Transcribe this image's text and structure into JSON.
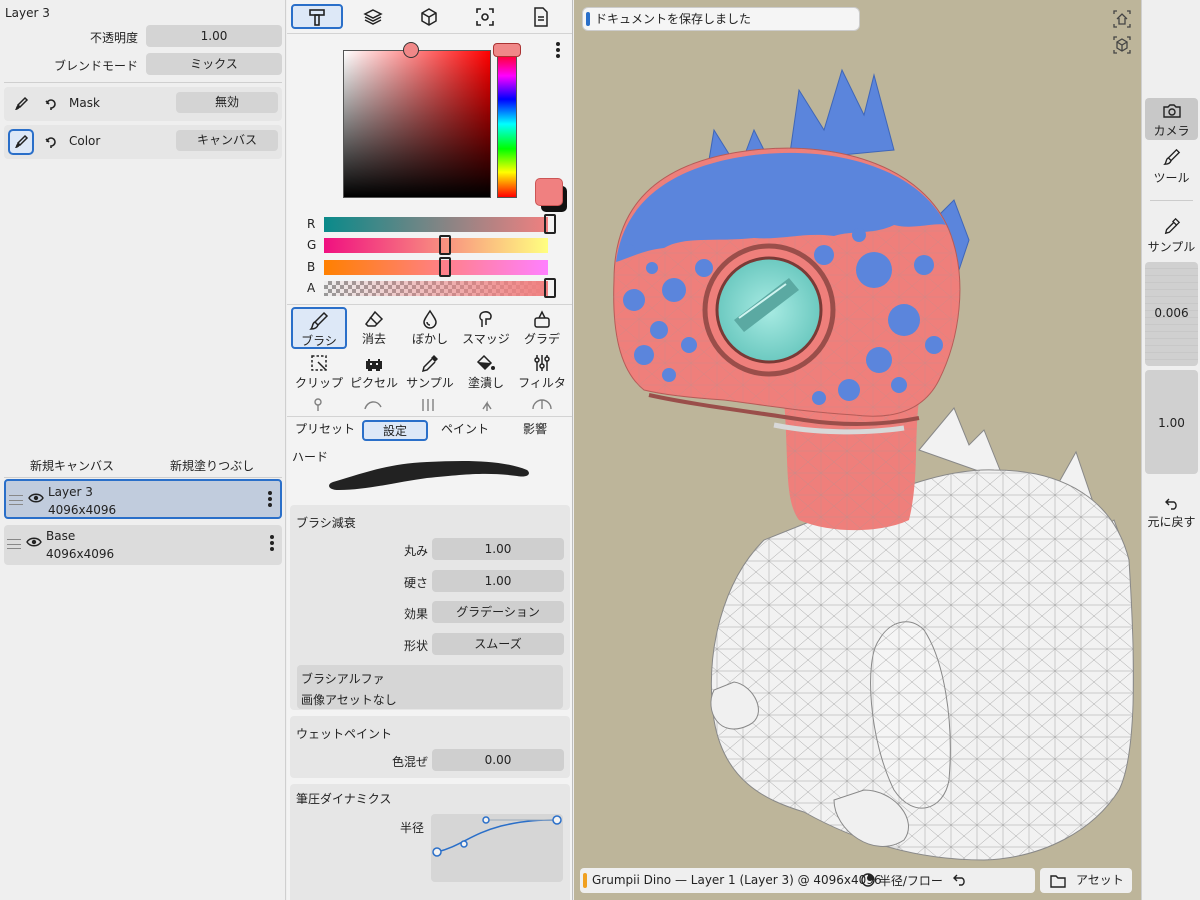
{
  "left_panel": {
    "layer_title": "Layer 3",
    "opacity_label": "不透明度",
    "opacity_value": "1.00",
    "blend_label": "ブレンドモード",
    "blend_value": "ミックス",
    "channels": [
      {
        "name": "Mask",
        "value": "無効"
      },
      {
        "name": "Color",
        "value": "キャンバス"
      }
    ],
    "new_canvas": "新規キャンバス",
    "new_fill": "新規塗りつぶし",
    "layers": [
      {
        "name": "Layer 3",
        "size": "4096x4096"
      },
      {
        "name": "Base",
        "size": "4096x4096"
      }
    ]
  },
  "color": {
    "current": "#f08080",
    "channels": [
      {
        "label": "R",
        "pos": 0.94
      },
      {
        "label": "G",
        "pos": 0.5
      },
      {
        "label": "B",
        "pos": 0.5
      },
      {
        "label": "A",
        "pos": 1.0
      }
    ]
  },
  "tools": [
    {
      "label": "ブラシ",
      "icon": "brush-icon",
      "selected": true
    },
    {
      "label": "消去",
      "icon": "eraser-icon"
    },
    {
      "label": "ぼかし",
      "icon": "blur-drop-icon"
    },
    {
      "label": "スマッジ",
      "icon": "smudge-icon"
    },
    {
      "label": "グラデ",
      "icon": "gradient-icon"
    },
    {
      "label": "クリップ",
      "icon": "clip-icon"
    },
    {
      "label": "ピクセル",
      "icon": "pixel-invader-icon"
    },
    {
      "label": "サンプル",
      "icon": "eyedropper-icon"
    },
    {
      "label": "塗潰し",
      "icon": "fill-bucket-icon"
    },
    {
      "label": "フィルタ",
      "icon": "filter-sliders-icon"
    }
  ],
  "subtabs": [
    "プリセット",
    "設定",
    "ペイント",
    "影響"
  ],
  "brush": {
    "preset_name": "ハード",
    "falloff_title": "ブラシ減衰",
    "roundness_label": "丸み",
    "roundness_value": "1.00",
    "hardness_label": "硬さ",
    "hardness_value": "1.00",
    "effect_label": "効果",
    "effect_value": "グラデーション",
    "shape_label": "形状",
    "shape_value": "スムーズ",
    "alpha_title": "ブラシアルファ",
    "alpha_value": "画像アセットなし",
    "wet_title": "ウェットペイント",
    "mix_label": "色混ぜ",
    "mix_value": "0.00",
    "pressure_title": "筆圧ダイナミクス",
    "radius_label": "半径"
  },
  "viewport": {
    "toast": "ドキュメントを保存しました",
    "status": "Grumpii Dino — Layer 1 (Layer 3) @ 4096x4096",
    "radius_flow": "半径/フロー",
    "assets": "アセット"
  },
  "right_toolbar": {
    "camera": "カメラ",
    "tool": "ツール",
    "sample": "サンプル",
    "radius_value": "0.006",
    "flow_value": "1.00",
    "undo": "元に戻す"
  }
}
